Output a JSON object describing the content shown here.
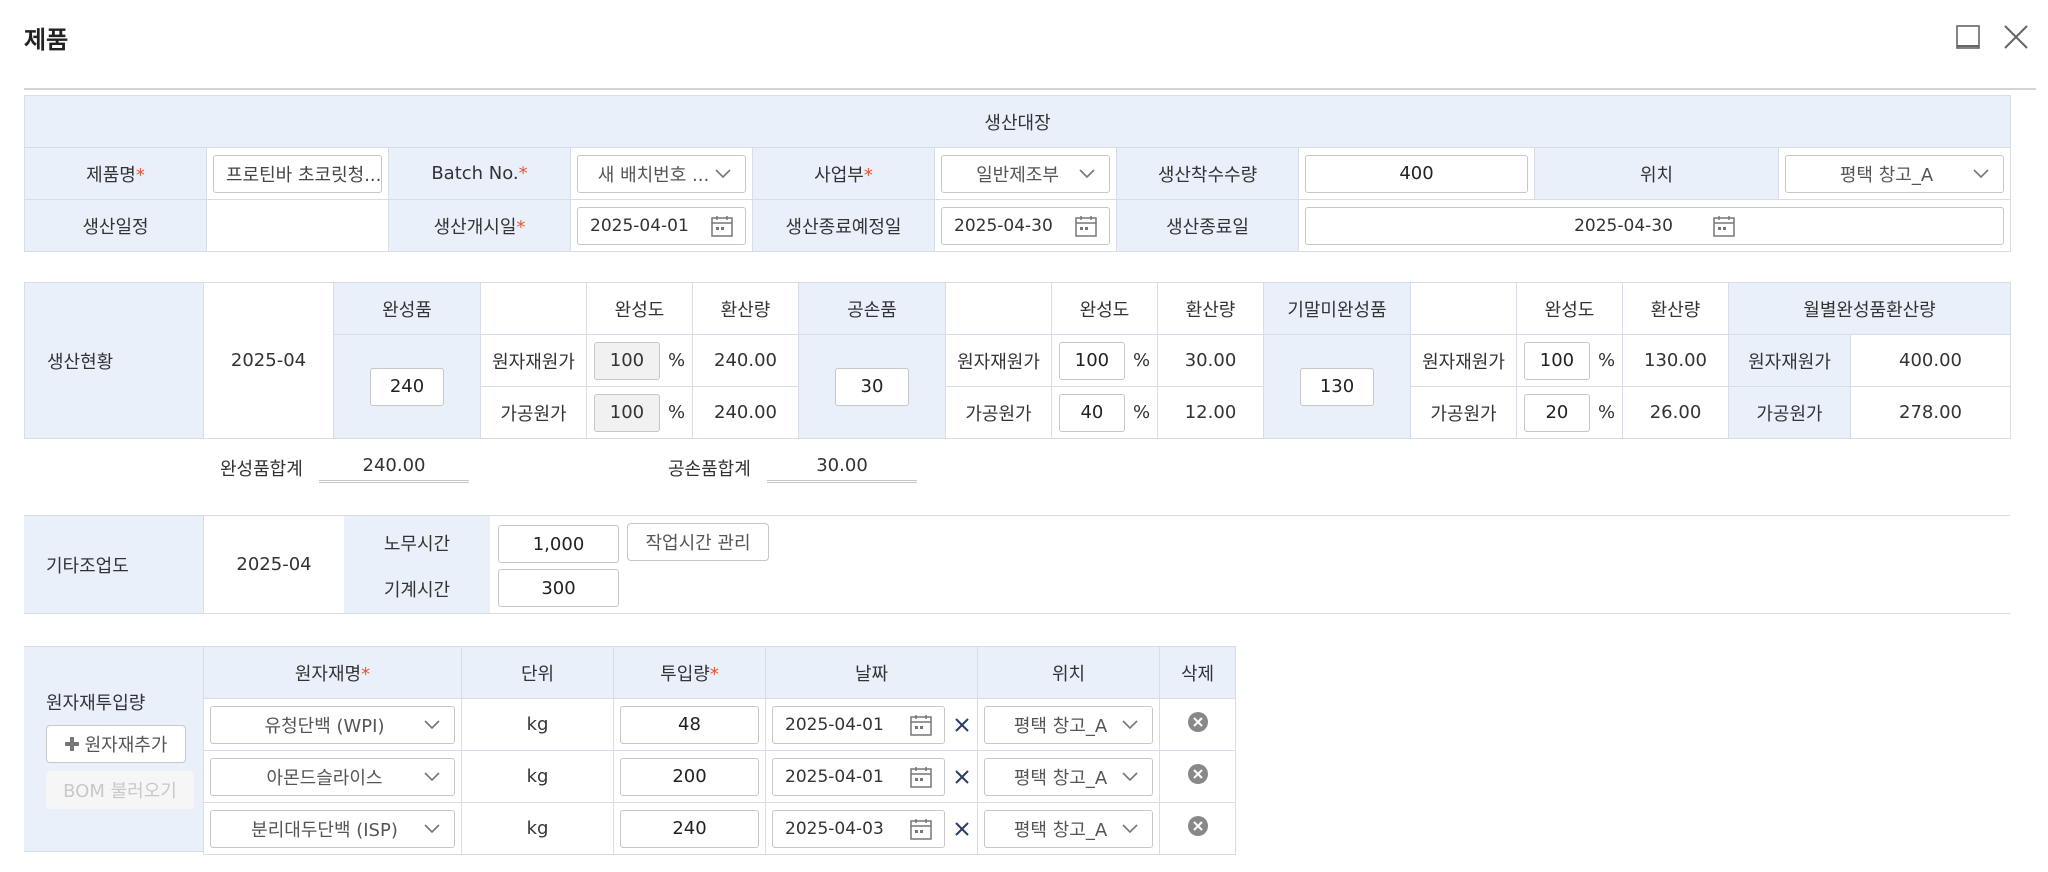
{
  "window": {
    "title": "제품"
  },
  "ledger": {
    "header": "생산대장",
    "product_name_label": "제품명",
    "product_name_value": "프로틴바 초코릿청...",
    "batch_label": "Batch No.",
    "batch_value": "새 배치번호 ...",
    "division_label": "사업부",
    "division_value": "일반제조부",
    "start_qty_label": "생산착수수량",
    "start_qty_value": "400",
    "location_label": "위치",
    "location_value": "평택 창고_A",
    "schedule_label": "생산일정",
    "start_date_label": "생산개시일",
    "start_date_value": "2025-04-01",
    "planned_end_label": "생산종료예정일",
    "planned_end_value": "2025-04-30",
    "end_date_label": "생산종료일",
    "end_date_value": "2025-04-30"
  },
  "status": {
    "label": "생산현황",
    "period": "2025-04",
    "finished_label": "완성품",
    "defect_label": "공손품",
    "wip_label": "기말미완성품",
    "monthly_label": "월별완성품환산량",
    "completion_label": "완성도",
    "converted_label": "환산량",
    "raw_cost_label": "원자재원가",
    "process_cost_label": "가공원가",
    "pct": "%",
    "finished_qty": "240",
    "finished_raw_pct": "100",
    "finished_raw_conv": "240.00",
    "finished_proc_pct": "100",
    "finished_proc_conv": "240.00",
    "defect_qty": "30",
    "defect_raw_pct": "100",
    "defect_raw_conv": "30.00",
    "defect_proc_pct": "40",
    "defect_proc_conv": "12.00",
    "wip_qty": "130",
    "wip_raw_pct": "100",
    "wip_raw_conv": "130.00",
    "wip_proc_pct": "20",
    "wip_proc_conv": "26.00",
    "monthly_raw_value": "400.00",
    "monthly_proc_value": "278.00"
  },
  "totals": {
    "finished_total_label": "완성품합계",
    "finished_total_value": "240.00",
    "defect_total_label": "공손품합계",
    "defect_total_value": "30.00"
  },
  "other": {
    "label": "기타조업도",
    "period": "2025-04",
    "labor_label": "노무시간",
    "labor_value": "1,000",
    "work_time_button": "작업시간 관리",
    "machine_label": "기계시간",
    "machine_value": "300"
  },
  "materials": {
    "label": "원자재투입량",
    "add_button": "원자재추가",
    "bom_button": "BOM 불러오기",
    "columns": {
      "name": "원자재명",
      "unit": "단위",
      "qty": "투입량",
      "date": "날짜",
      "location": "위치",
      "delete": "삭제"
    },
    "rows": [
      {
        "name": "유청단백 (WPI)",
        "unit": "kg",
        "qty": "48",
        "date": "2025-04-01",
        "location": "평택 창고_A"
      },
      {
        "name": "아몬드슬라이스",
        "unit": "kg",
        "qty": "200",
        "date": "2025-04-01",
        "location": "평택 창고_A"
      },
      {
        "name": "분리대두단백 (ISP)",
        "unit": "kg",
        "qty": "240",
        "date": "2025-04-03",
        "location": "평택 창고_A"
      }
    ]
  },
  "colors": {
    "header_bg": "#eaf0fa",
    "border": "#d7dde7",
    "required": "#e8542f"
  }
}
